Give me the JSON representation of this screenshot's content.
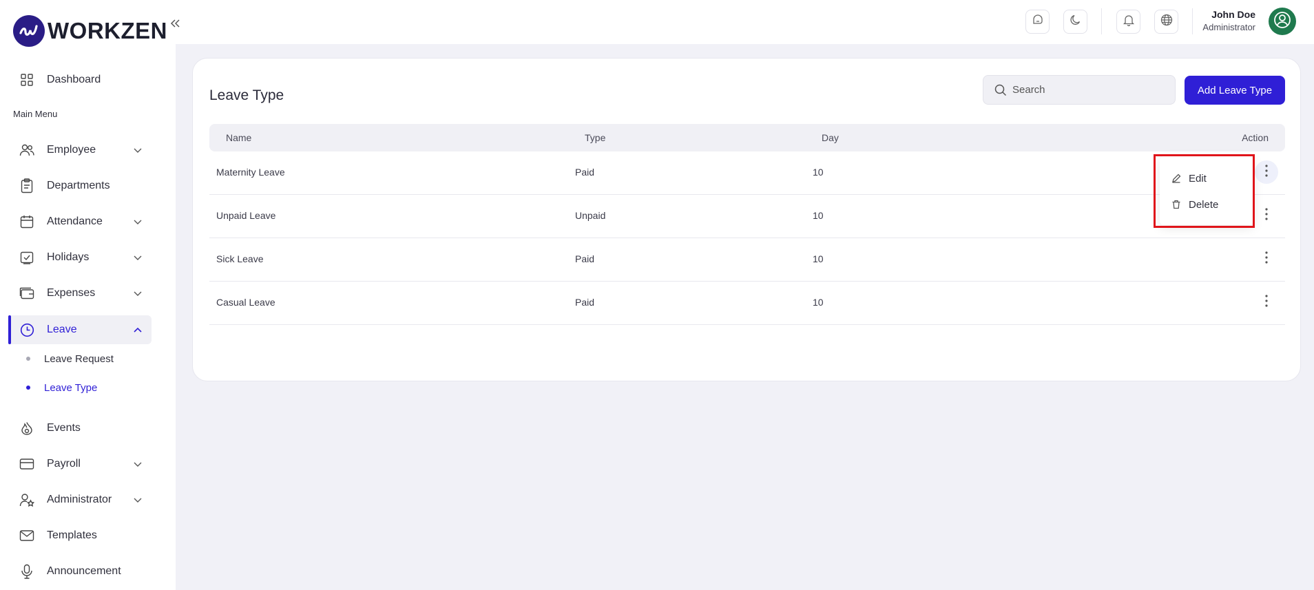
{
  "app": {
    "name": "WORKZEN",
    "accent": "#2f1fd6"
  },
  "sidebar": {
    "dashboard": "Dashboard",
    "section": "Main Menu",
    "items": [
      {
        "label": "Employee",
        "icon": "users-icon",
        "expandable": true
      },
      {
        "label": "Departments",
        "icon": "clipboard-icon",
        "expandable": false
      },
      {
        "label": "Attendance",
        "icon": "calendar-icon",
        "expandable": true
      },
      {
        "label": "Holidays",
        "icon": "calendar-check-icon",
        "expandable": true
      },
      {
        "label": "Expenses",
        "icon": "wallet-icon",
        "expandable": true
      },
      {
        "label": "Leave",
        "icon": "clock-icon",
        "expandable": true,
        "active": true
      },
      {
        "label": "Events",
        "icon": "flame-icon",
        "expandable": false
      },
      {
        "label": "Payroll",
        "icon": "credit-card-icon",
        "expandable": true
      },
      {
        "label": "Administrator",
        "icon": "user-star-icon",
        "expandable": true
      },
      {
        "label": "Templates",
        "icon": "mail-icon",
        "expandable": false
      },
      {
        "label": "Announcement",
        "icon": "mic-icon",
        "expandable": false
      }
    ],
    "leave_sub": [
      {
        "label": "Leave Request",
        "active": false
      },
      {
        "label": "Leave Type",
        "active": true
      }
    ]
  },
  "topbar": {
    "icons": [
      "bubble-icon",
      "moon-icon",
      "bell-icon",
      "globe-icon"
    ],
    "user": {
      "name": "John Doe",
      "role": "Administrator"
    }
  },
  "main": {
    "title": "Leave Type",
    "search_placeholder": "Search",
    "add_button": "Add Leave Type",
    "columns": [
      "Name",
      "Type",
      "Day",
      "Action"
    ],
    "rows": [
      {
        "name": "Maternity Leave",
        "type": "Paid",
        "day": "10"
      },
      {
        "name": "Unpaid Leave",
        "type": "Unpaid",
        "day": "10"
      },
      {
        "name": "Sick Leave",
        "type": "Paid",
        "day": "10"
      },
      {
        "name": "Casual Leave",
        "type": "Paid",
        "day": "10"
      }
    ],
    "action_menu": {
      "edit": "Edit",
      "delete": "Delete"
    }
  }
}
